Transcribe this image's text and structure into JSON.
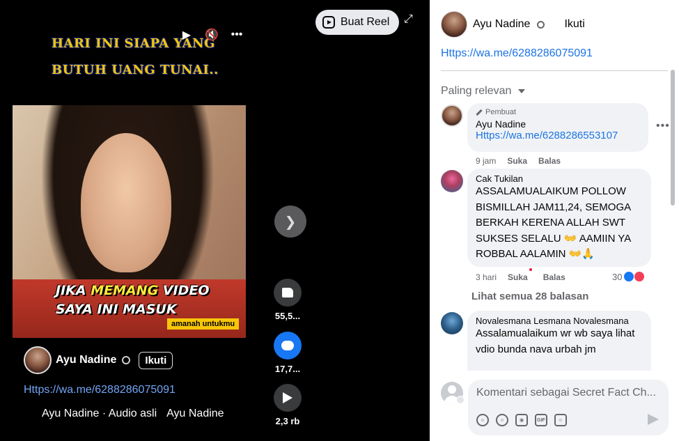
{
  "video": {
    "overlay_line1": "HARI INI SIAPA YANG",
    "overlay_line2": "BUTUH UANG TUNAI..",
    "controls": {
      "play_icon": "play-icon",
      "mute_icon": "volume-muted-icon",
      "more_icon": "more-icon"
    },
    "create_reel_label": "Buat Reel",
    "thumbnail": {
      "caption_line1_highlight": "MEMANG",
      "caption_line1_pre": "JIKA ",
      "caption_line1_post": " VIDEO",
      "caption_line2": "SAYA INI MASUK",
      "tag": "amanah untukmu"
    },
    "actions": {
      "like_count": "55,5...",
      "comment_count": "17,7...",
      "share_count": "2,3 rb"
    },
    "creator_name": "Ayu Nadine",
    "follow_label": "Ikuti",
    "link": "Https://wa.me/6288286075091",
    "audio_text": "Ayu Nadine · Audio asli",
    "audio_text_2": "Ayu Nadine"
  },
  "sidebar": {
    "author_name": "Ayu Nadine",
    "follow_label": "Ikuti",
    "link": "Https://wa.me/6288286075091",
    "sort_label": "Paling relevan",
    "comments": [
      {
        "badge": "Pembuat",
        "name": "Ayu Nadine",
        "link": "Https://wa.me/6288286553107",
        "time": "9 jam",
        "like": "Suka",
        "reply": "Balas"
      },
      {
        "name": "Cak Tukilan",
        "text": "ASSALAMUALAIKUM POLLOW BISMILLAH JAM11,24, SEMOGA BERKAH KERENA ALLAH SWT SUKSES SELALU 👐 AAMIIN YA ROBBAL AALAMIN 👐🙏",
        "time": "3 hari",
        "like": "Suka",
        "reply": "Balas",
        "reaction_count": "30"
      },
      {
        "name": "Novalesmana Lesmana Novalesmana",
        "text": "Assalamualaikum wr wb saya lihat vdio bunda nava urbah jm"
      }
    ],
    "see_replies": "Lihat semua 28 balasan",
    "compose_placeholder": "Komentari sebagai Secret Fact Ch..."
  },
  "colors": {
    "link": "#1b74e4",
    "accent": "#1877f2",
    "love": "#f33e58"
  }
}
